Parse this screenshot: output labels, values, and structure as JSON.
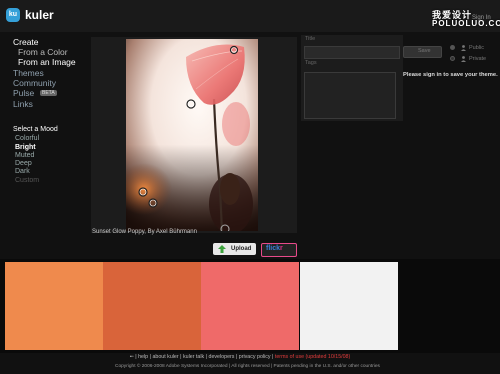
{
  "header": {
    "logo_badge": "ku",
    "logo_text": "kuler",
    "sign_in": "Sign In",
    "watermark_line1": "我爱设计",
    "watermark_line2": "POLUOLUO.COM"
  },
  "nav": {
    "create": "Create",
    "from_color": "From a Color",
    "from_image": "From an Image",
    "themes": "Themes",
    "community": "Community",
    "pulse": "Pulse",
    "beta": "BETA",
    "links": "Links"
  },
  "mood": {
    "title": "Select a Mood",
    "options": [
      "Colorful",
      "Bright",
      "Muted",
      "Deep",
      "Dark",
      "Custom"
    ],
    "selected": "Bright"
  },
  "image": {
    "caption": "Sunset Glow Poppy, By Axel Bührmann",
    "upload_label": "Upload",
    "flickr_label_a": "flick",
    "flickr_label_b": "r"
  },
  "form": {
    "title_label": "Title",
    "title_value": "",
    "tags_label": "Tags",
    "tags_value": "",
    "save_label": "Save",
    "public_label": "Public",
    "private_label": "Private",
    "signin_message": "Please sign in to save your theme."
  },
  "swatches": [
    "#ef8a4d",
    "#d9643a",
    "#ef6a69",
    "#f2f2f2",
    "#0a0a0a"
  ],
  "footer": {
    "links": [
      "help",
      "about kuler",
      "kuler talk",
      "developers",
      "privacy policy"
    ],
    "terms": "terms of use (updated 10/15/08)",
    "copyright": "Copyright © 2006-2008 Adobe Systems Incorporated | All rights reserved | Patents pending in the U.S. and/or other countries"
  }
}
